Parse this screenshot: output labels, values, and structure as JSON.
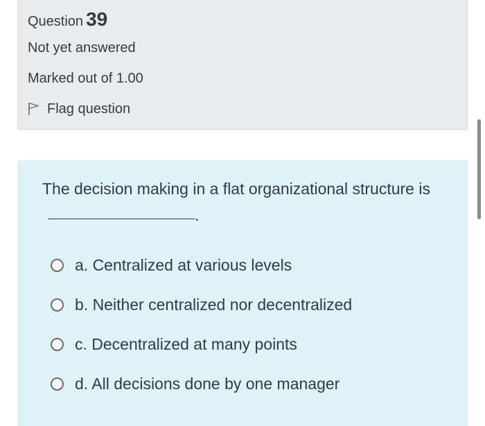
{
  "question_info": {
    "label": "Question",
    "number": "39",
    "state": "Not yet answered",
    "grade": "Marked out of 1.00",
    "flag_label": "Flag question"
  },
  "question": {
    "text": "The decision making in a flat organizational structure is",
    "text_end": "."
  },
  "options": [
    {
      "label": "a. Centralized at various levels"
    },
    {
      "label": "b. Neither centralized nor decentralized"
    },
    {
      "label": "c. Decentralized at many points"
    },
    {
      "label": "d. All decisions done by one manager"
    }
  ],
  "colors": {
    "info_background": "#e9ecef",
    "content_background": "#def2f8",
    "text": "#373a3c"
  }
}
